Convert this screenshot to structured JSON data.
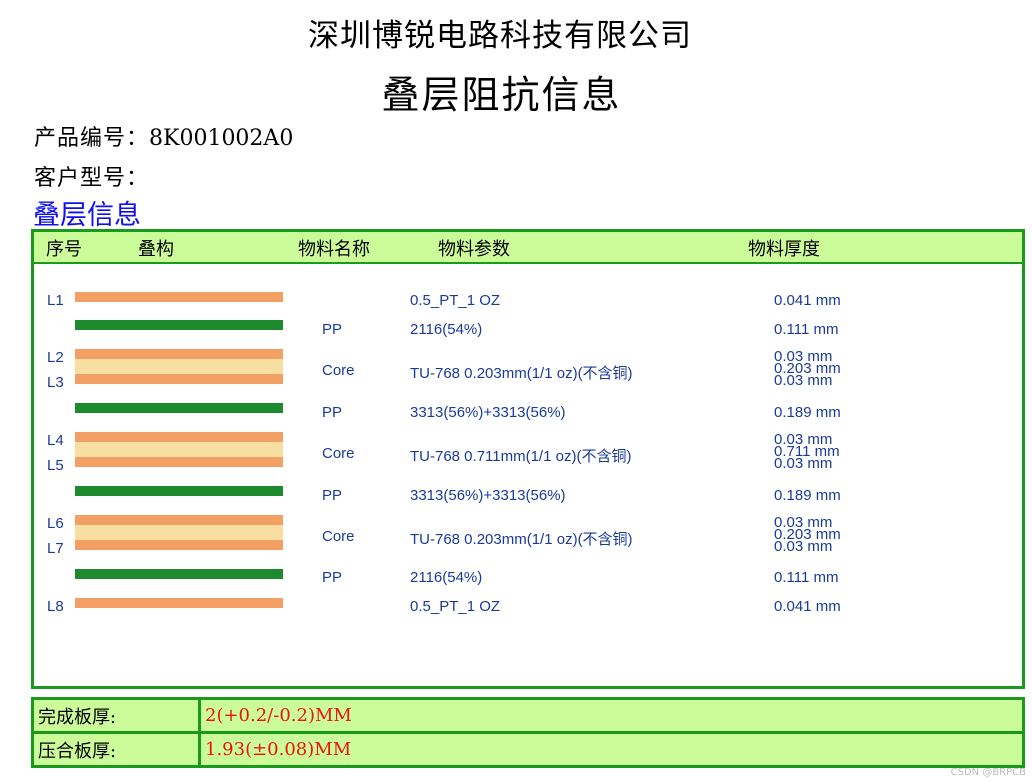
{
  "header": {
    "company": "深圳博锐电路科技有限公司",
    "title": "叠层阻抗信息"
  },
  "product": {
    "number_label": "产品编号：",
    "number_value": "8K001002A0",
    "customer_label": "客户型号：",
    "customer_value": ""
  },
  "section_title": "叠层信息",
  "stack_table": {
    "headers": {
      "seq": "序号",
      "structure": "叠构",
      "material_name": "物料名称",
      "material_param": "物料参数",
      "thickness": "物料厚度"
    },
    "rows": [
      {
        "layer": "L1",
        "type": "copper",
        "name": "",
        "param": "0.5_PT_1 OZ",
        "thickness": "0.041 mm"
      },
      {
        "type": "prepreg",
        "name": "PP",
        "param": "2116(54%)",
        "thickness": "0.111 mm"
      },
      {
        "layer_top": "L2",
        "layer_bottom": "L3",
        "type": "core",
        "name": "Core",
        "param": "TU-768 0.203mm(1/1 oz)(不含铜)",
        "thickness_top": "0.03 mm",
        "thickness_mid": "0.203 mm",
        "thickness_bottom": "0.03 mm"
      },
      {
        "type": "prepreg",
        "name": "PP",
        "param": "3313(56%)+3313(56%)",
        "thickness": "0.189 mm"
      },
      {
        "layer_top": "L4",
        "layer_bottom": "L5",
        "type": "core",
        "name": "Core",
        "param": "TU-768 0.711mm(1/1 oz)(不含铜)",
        "thickness_top": "0.03 mm",
        "thickness_mid": "0.711 mm",
        "thickness_bottom": "0.03 mm"
      },
      {
        "type": "prepreg",
        "name": "PP",
        "param": "3313(56%)+3313(56%)",
        "thickness": "0.189 mm"
      },
      {
        "layer_top": "L6",
        "layer_bottom": "L7",
        "type": "core",
        "name": "Core",
        "param": "TU-768 0.203mm(1/1 oz)(不含铜)",
        "thickness_top": "0.03 mm",
        "thickness_mid": "0.203 mm",
        "thickness_bottom": "0.03 mm"
      },
      {
        "type": "prepreg",
        "name": "PP",
        "param": "2116(54%)",
        "thickness": "0.111 mm"
      },
      {
        "layer": "L8",
        "type": "copper",
        "name": "",
        "param": "0.5_PT_1 OZ",
        "thickness": "0.041 mm"
      }
    ]
  },
  "summary": {
    "finished_label": "完成板厚:",
    "finished_value": "2(+0.2/-0.2)MM",
    "pressed_label": "压合板厚:",
    "pressed_value": "1.93(±0.08)MM"
  },
  "watermark": "CSDN @BRPCB",
  "colors": {
    "copper": "#f4a064",
    "prepreg": "#1e8a2e",
    "core": "#f8dea0",
    "header_bg": "#ccfc99",
    "border": "#1a9a1a",
    "section_title": "#1010ee",
    "value_red": "#ee1111",
    "table_text": "#1a3a99"
  }
}
